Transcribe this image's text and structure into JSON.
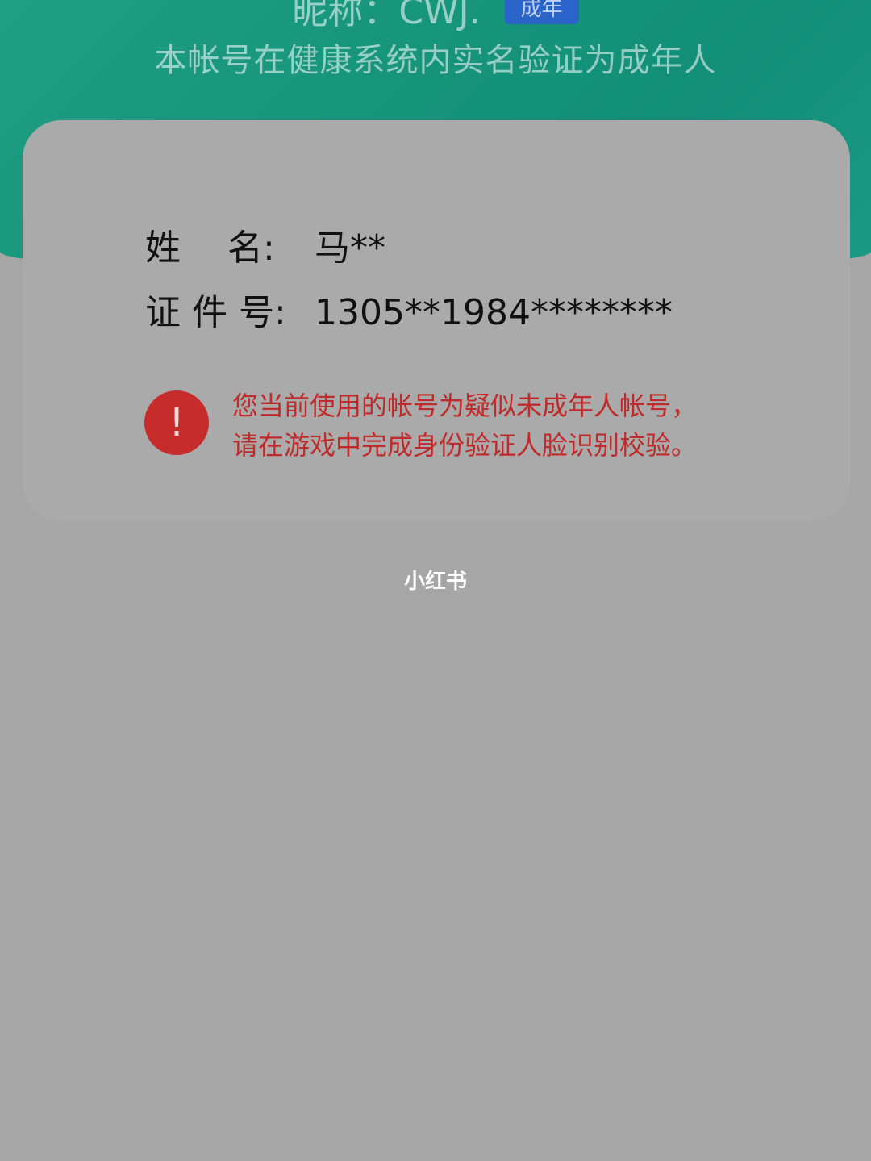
{
  "header": {
    "nickname_line": "昵称：CWJ.",
    "nickname_badge": "成年",
    "subtitle": "本帐号在健康系统内实名验证为成年人"
  },
  "card": {
    "name_label": "姓　 名:",
    "name_value": "马**",
    "id_label": "证 件 号:",
    "id_value": "1305**1984********",
    "warning_icon": "!",
    "warning_line1": "您当前使用的帐号为疑似未成年人帐号，",
    "warning_line2": "请在游戏中完成身份验证人脸识别校验。"
  },
  "watermark": "小红书",
  "colors": {
    "header_green": "#17957a",
    "warning_red": "#c62c2c",
    "background_gray": "#a6a6a6"
  },
  "icons": {
    "warning": "exclamation-circle-icon"
  }
}
